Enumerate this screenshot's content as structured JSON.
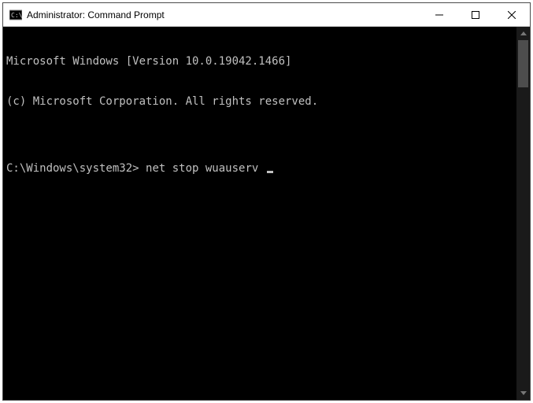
{
  "window": {
    "title": "Administrator: Command Prompt"
  },
  "terminal": {
    "line1": "Microsoft Windows [Version 10.0.19042.1466]",
    "line2": "(c) Microsoft Corporation. All rights reserved.",
    "blank": "",
    "prompt": "C:\\Windows\\system32>",
    "command": "net stop wuauserv"
  }
}
